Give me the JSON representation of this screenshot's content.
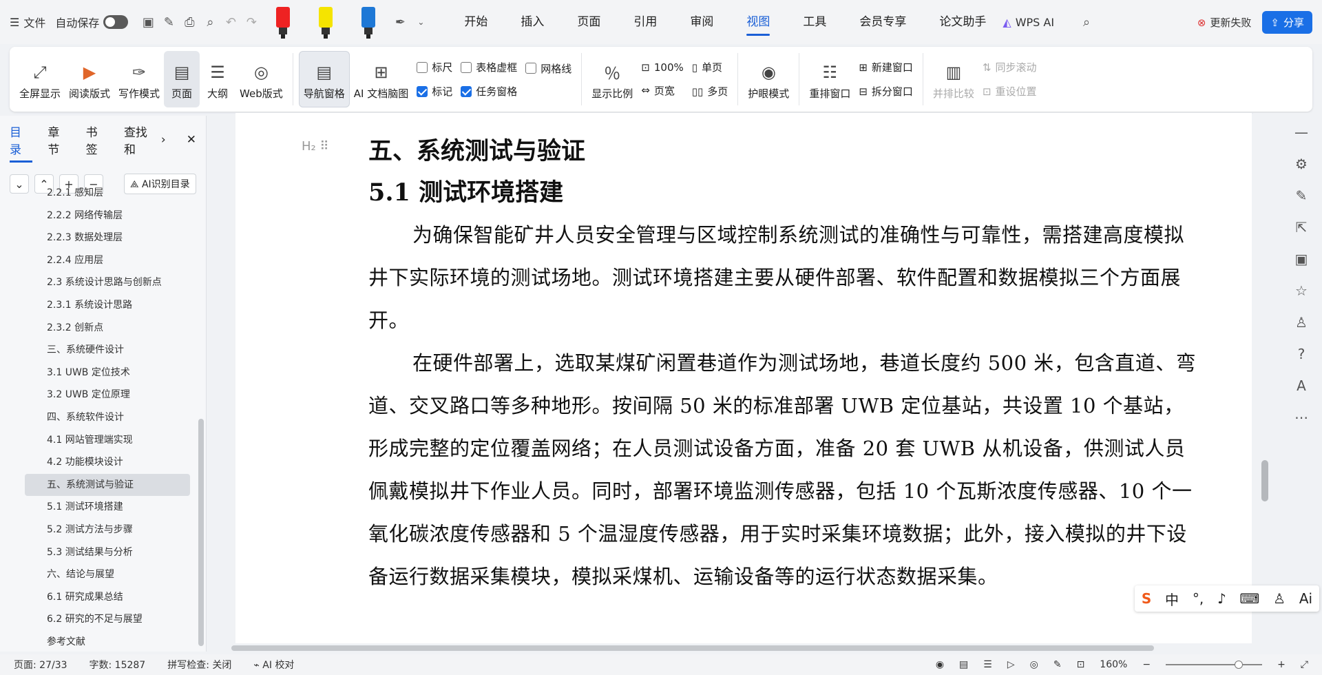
{
  "topbar": {
    "file": "文件",
    "autosave": "自动保存",
    "menu": [
      "开始",
      "插入",
      "页面",
      "引用",
      "审阅",
      "视图",
      "工具",
      "会员专享",
      "论文助手"
    ],
    "active_menu": "视图",
    "wps_ai": "WPS AI",
    "update_fail": "更新失败",
    "share": "分享"
  },
  "ribbon": {
    "fullscreen": "全屏显示",
    "read": "阅读版式",
    "write": "写作模式",
    "page": "页面",
    "outline": "大纲",
    "web": "Web版式",
    "navpane": "导航窗格",
    "ai_mindmap": "AI 文档脑图",
    "ruler": "标尺",
    "table_grid": "表格虚框",
    "gridline": "网格线",
    "marks": "标记",
    "taskpane": "任务窗格",
    "zoom_ratio": "显示比例",
    "zoom100": "100%",
    "pagewidth": "页宽",
    "single": "单页",
    "multi": "多页",
    "eyecare": "护眼模式",
    "rearrange": "重排窗口",
    "newwin": "新建窗口",
    "split": "拆分窗口",
    "sidebyside": "并排比较",
    "syncscroll": "同步滚动",
    "resetpos": "重设位置"
  },
  "sidebar": {
    "tabs": [
      "目录",
      "章节",
      "书签",
      "查找和"
    ],
    "ai_toc": "AI识别目录",
    "toc": [
      "2.2.1 感知层",
      "2.2.2 网络传输层",
      "2.2.3 数据处理层",
      "2.2.4 应用层",
      "2.3 系统设计思路与创新点",
      "2.3.1 系统设计思路",
      "2.3.2 创新点",
      "三、系统硬件设计",
      "3.1 UWB 定位技术",
      "3.2 UWB 定位原理",
      "四、系统软件设计",
      "4.1 网站管理端实现",
      "4.2 功能模块设计",
      "五、系统测试与验证",
      "5.1 测试环境搭建",
      "5.2 测试方法与步骤",
      "5.3 测试结果与分析",
      "六、结论与展望",
      "6.1 研究成果总结",
      "6.2 研究的不足与展望",
      "参考文献"
    ],
    "selected": "五、系统测试与验证"
  },
  "doc": {
    "h1": "五、系统测试与验证",
    "h2": "5.1 测试环境搭建",
    "p1": "为确保智能矿井人员安全管理与区域控制系统测试的准确性与可靠性，需搭建高度模拟井下实际环境的测试场地。测试环境搭建主要从硬件部署、软件配置和数据模拟三个方面展开。",
    "p2": "在硬件部署上，选取某煤矿闲置巷道作为测试场地，巷道长度约 500 米，包含直道、弯道、交叉路口等多种地形。按间隔 50 米的标准部署 UWB 定位基站，共设置 10 个基站，形成完整的定位覆盖网络；在人员测试设备方面，准备 20 套 UWB 从机设备，供测试人员佩戴模拟井下作业人员。同时，部署环境监测传感器，包括 10 个瓦斯浓度传感器、10 个一氧化碳浓度传感器和 5 个温湿度传感器，用于实时采集环境数据；此外，接入模拟的井下设备运行数据采集模块，模拟采煤机、运输设备等的运行状态数据采集。"
  },
  "status": {
    "page": "页面: 27/33",
    "words": "字数: 15287",
    "spell": "拼写检查: 关闭",
    "ai_check": "AI 校对",
    "zoom": "160%"
  },
  "ime": {
    "lang": "中",
    "ai": "Ai"
  }
}
